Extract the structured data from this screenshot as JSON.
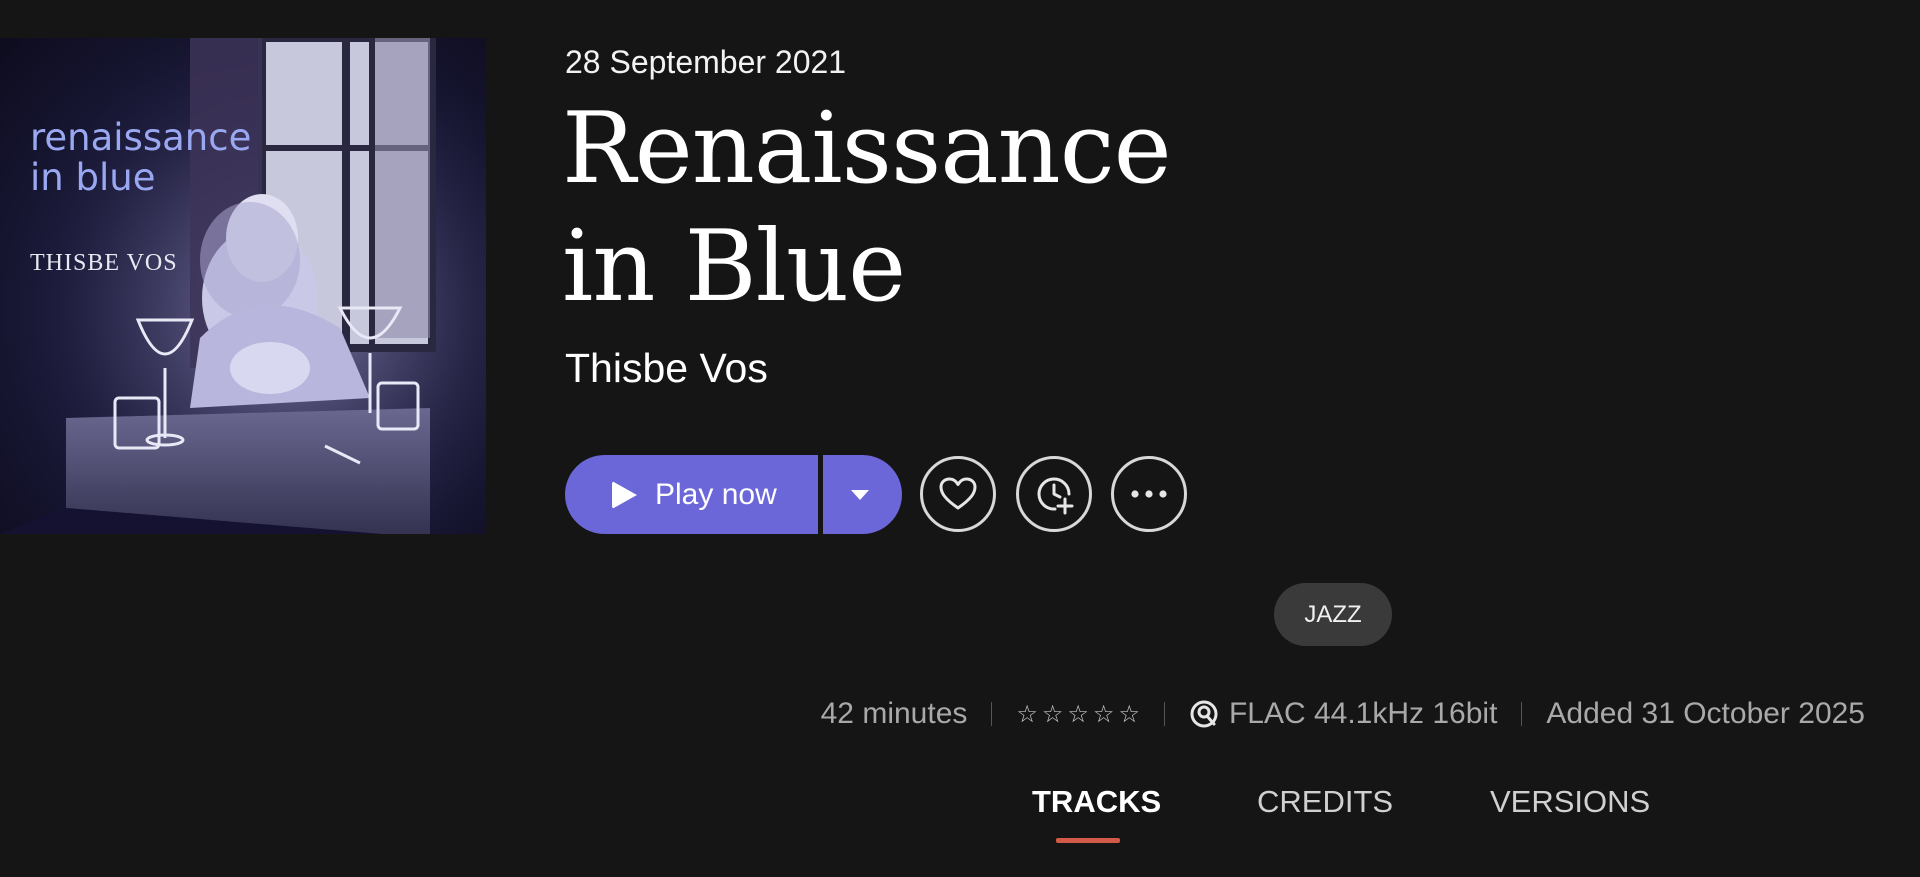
{
  "album_art": {
    "title_text": "renaissance\nin blue",
    "artist_text": "THISBE VOS"
  },
  "album": {
    "release_date": "28 September 2021",
    "title": "Renaissance in Blue",
    "artist": "Thisbe Vos"
  },
  "actions": {
    "play_label": "Play now",
    "icons": [
      "play-icon",
      "chevron-down-icon",
      "heart-icon",
      "clock-plus-icon",
      "more-icon"
    ]
  },
  "genre": "JAZZ",
  "meta": {
    "duration": "42 minutes",
    "rating_stars": 5,
    "rating_filled": 0,
    "quality": "FLAC 44.1kHz 16bit",
    "added": "Added 31 October 2025"
  },
  "tabs": [
    {
      "label": "TRACKS",
      "active": true
    },
    {
      "label": "CREDITS",
      "active": false
    },
    {
      "label": "VERSIONS",
      "active": false
    }
  ],
  "colors": {
    "background": "#151515",
    "accent": "#6b67d8",
    "tab_underline": "#d35a49",
    "chip": "#3a3a3a"
  }
}
